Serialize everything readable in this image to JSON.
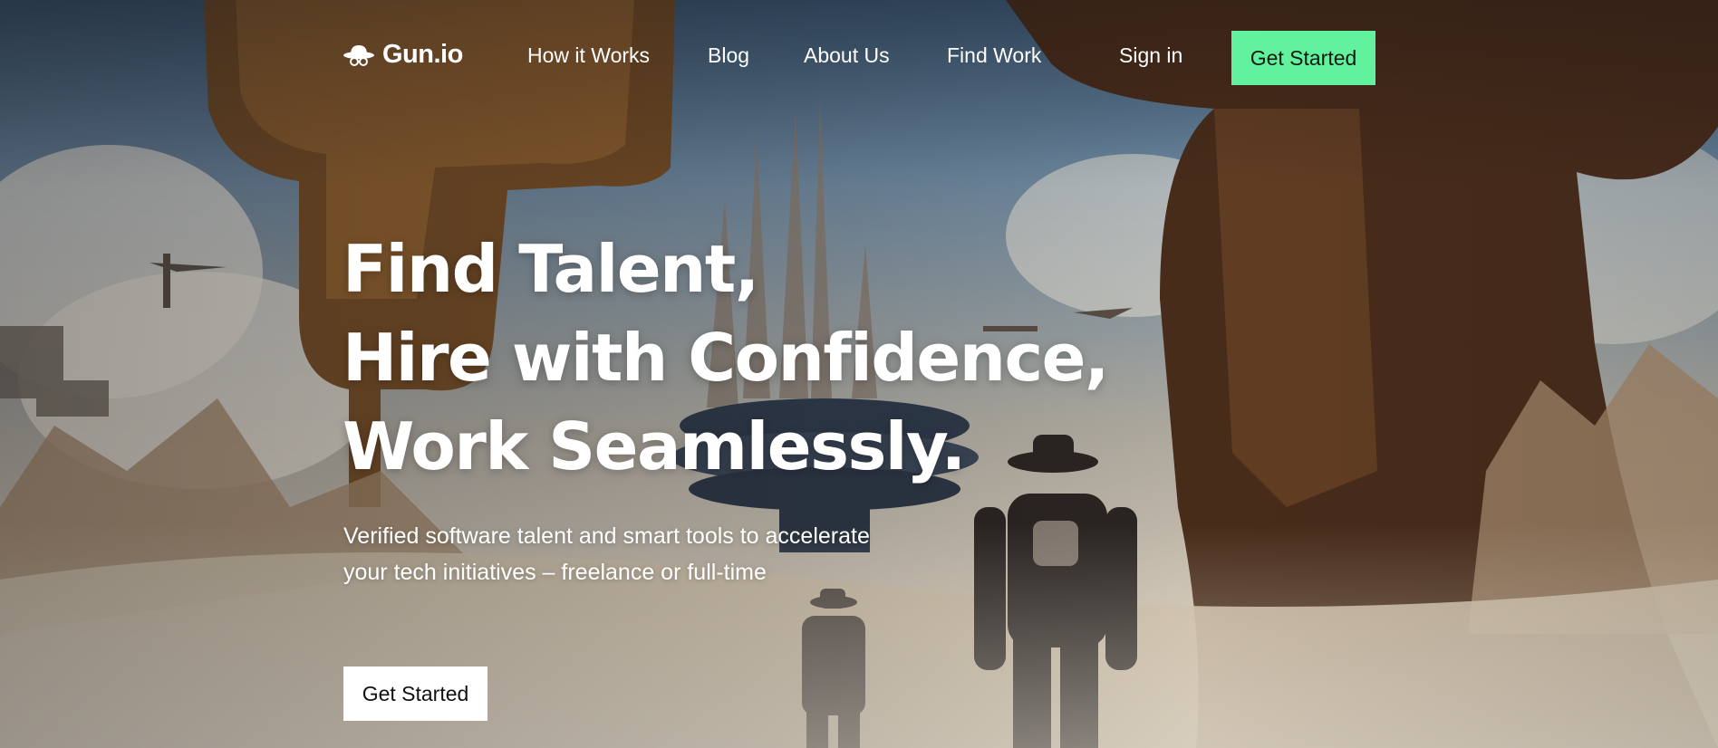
{
  "brand": {
    "name": "Gun.io",
    "icon": "cowboy-hat-glasses-icon"
  },
  "nav": {
    "links": [
      {
        "label": "How it Works"
      },
      {
        "label": "Blog"
      },
      {
        "label": "About Us"
      },
      {
        "label": "Find Work"
      }
    ],
    "sign_in": "Sign in",
    "cta": "Get Started"
  },
  "hero": {
    "headline_lines": [
      "Find Talent,",
      "Hire with Confidence,",
      "Work Seamlessly."
    ],
    "subtitle": "Verified software talent and smart tools to accelerate your tech initiatives – freelance or full-time",
    "cta": "Get Started"
  },
  "colors": {
    "accent": "#62f29e",
    "text_light": "#ffffff",
    "button_light": "#ffffff"
  }
}
